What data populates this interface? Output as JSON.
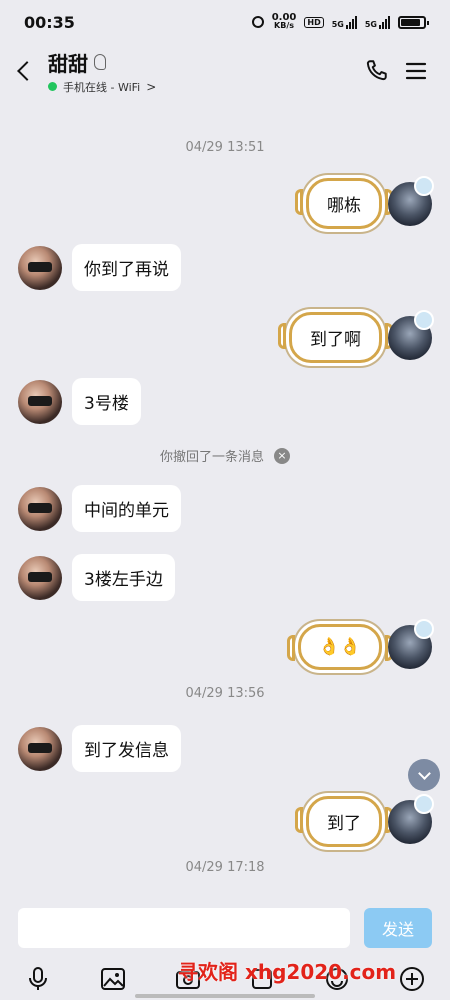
{
  "status_bar": {
    "time": "00:35",
    "speed_value": "0.00",
    "speed_unit": "KB/s",
    "hd_label": "HD",
    "network_1": "5G",
    "network_2": "5G"
  },
  "header": {
    "contact_name": "甜甜",
    "status_text": "手机在线 - WiFi",
    "status_chevron": ">",
    "online_color": "#22c55e"
  },
  "messages": {
    "ts1": "04/29 13:51",
    "m1": "哪栋",
    "m2": "你到了再说",
    "m3": "到了啊",
    "m4": "3号楼",
    "recall": "你撤回了一条消息",
    "m5": "中间的单元",
    "m6": "3楼左手边",
    "m7": "👌👌",
    "ts2": "04/29 13:56",
    "m8": "到了发信息",
    "m9": "到了",
    "ts3": "04/29 17:18"
  },
  "input": {
    "value": "",
    "send_label": "发送",
    "send_color": "#8ccaf3"
  },
  "toolbar": {
    "icons": [
      "microphone-icon",
      "image-icon",
      "camera-icon",
      "file-icon",
      "emoji-icon",
      "plus-icon"
    ]
  },
  "watermark": "寻欢阁 xhg2020.com",
  "colors": {
    "background": "#ebebf0",
    "bubble_border": "#d4a64a"
  }
}
